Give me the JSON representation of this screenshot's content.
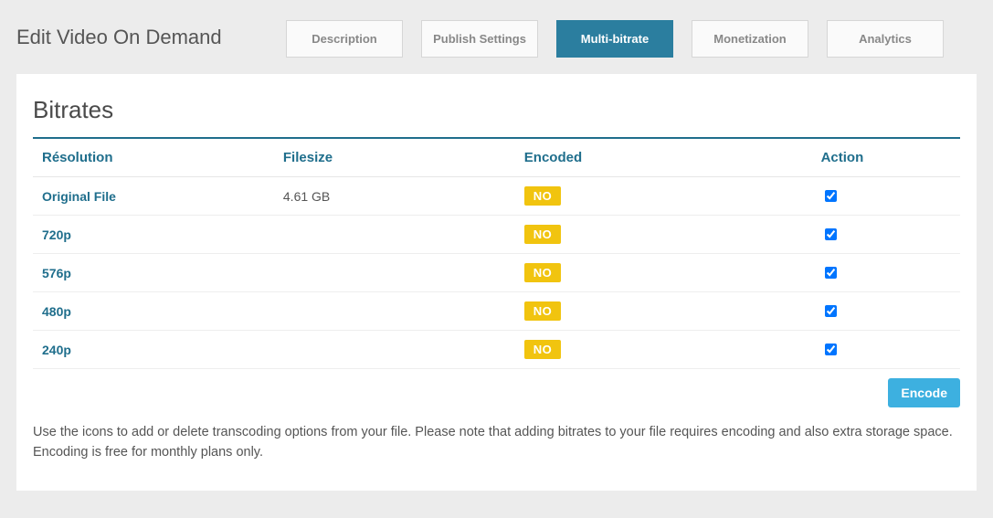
{
  "header": {
    "title": "Edit Video On Demand"
  },
  "tabs": [
    {
      "label": "Description",
      "active": false
    },
    {
      "label": "Publish Settings",
      "active": false
    },
    {
      "label": "Multi-bitrate",
      "active": true
    },
    {
      "label": "Monetization",
      "active": false
    },
    {
      "label": "Analytics",
      "active": false
    }
  ],
  "bitrates": {
    "heading": "Bitrates",
    "columns": {
      "resolution": "Résolution",
      "filesize": "Filesize",
      "encoded": "Encoded",
      "action": "Action"
    },
    "rows": [
      {
        "resolution": "Original File",
        "filesize": "4.61 GB",
        "encoded": "NO",
        "checked": true
      },
      {
        "resolution": "720p",
        "filesize": "",
        "encoded": "NO",
        "checked": true
      },
      {
        "resolution": "576p",
        "filesize": "",
        "encoded": "NO",
        "checked": true
      },
      {
        "resolution": "480p",
        "filesize": "",
        "encoded": "NO",
        "checked": true
      },
      {
        "resolution": "240p",
        "filesize": "",
        "encoded": "NO",
        "checked": true
      }
    ],
    "encode_button": "Encode",
    "helper_text": "Use the icons to add or delete transcoding options from your file. Please note that adding bitrates to your file requires encoding and also extra storage space. Encoding is free for monthly plans only."
  }
}
